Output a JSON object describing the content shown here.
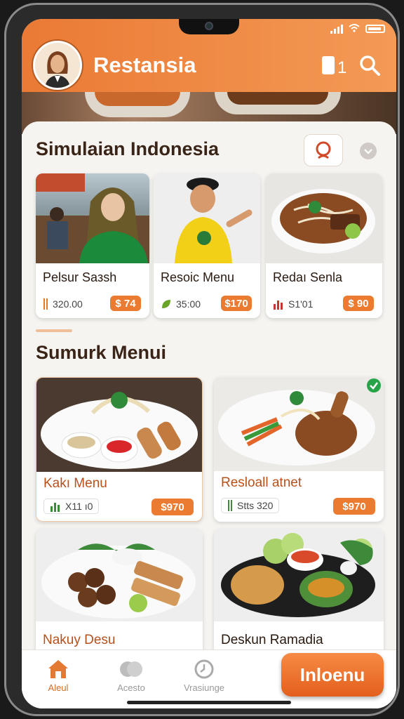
{
  "app": {
    "title": "Restansia"
  },
  "colors": {
    "accent": "#ec7b32",
    "header": "#f0893f",
    "title_text": "#3a2417"
  },
  "header": {
    "icons": [
      "avatar",
      "book-icon",
      "search-icon"
    ],
    "count": "1"
  },
  "section1": {
    "title": "Simulaian Indonesia",
    "items": [
      {
        "name": "Pelsur Saзsh",
        "meta": "320.00",
        "price": "$ 74",
        "icon": "bar-icon"
      },
      {
        "name": "Resoic Menu",
        "meta": "35:00",
        "price": "$170",
        "icon": "leaf-icon"
      },
      {
        "name": "Redaı Senla",
        "meta": "S1'01",
        "price": "$ 90",
        "icon": "chart-icon"
      }
    ]
  },
  "section2": {
    "title": "Sumurk Menui",
    "items": [
      {
        "name": "Kakı Menu",
        "meta": "X11 ı0",
        "price": "$970",
        "icon": "chart-icon"
      },
      {
        "name": "Resloall atnet",
        "meta": "Stts 320",
        "price": "$970",
        "icon": "bar-icon"
      },
      {
        "name": "Nakuy Desu",
        "meta": "",
        "price": ""
      },
      {
        "name": "Deskun Ramadia",
        "meta": "",
        "price": ""
      }
    ]
  },
  "navbar": {
    "items": [
      {
        "label": "Aleul",
        "icon": "home-icon",
        "active": true
      },
      {
        "label": "Acesto",
        "icon": "food-icon",
        "active": false
      },
      {
        "label": "Vrasiunge",
        "icon": "clock-icon",
        "active": false
      }
    ],
    "cta": "Inloenu"
  }
}
